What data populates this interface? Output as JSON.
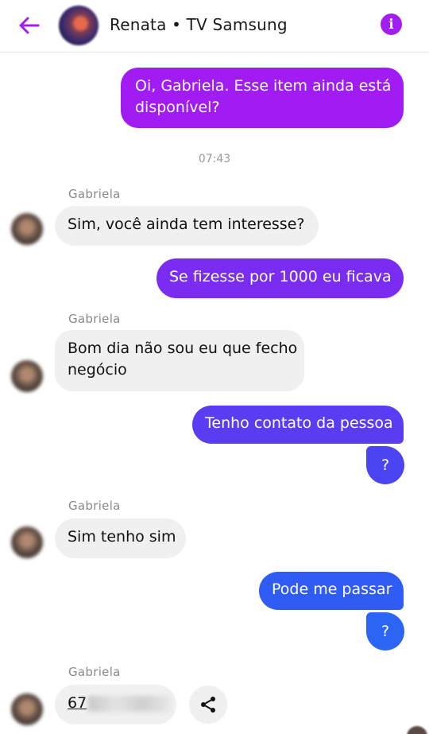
{
  "header": {
    "title": "Renata • TV Samsung",
    "back_icon": "arrow-left-icon",
    "info_icon": "info-icon",
    "info_glyph": "i",
    "accent": "#a21ef0"
  },
  "messages": {
    "m1": {
      "text_line1": "Oi, Gabriela. Esse item ainda está",
      "text_line2": "disponível?",
      "color": "#a01cf2"
    },
    "time1": "07:43",
    "s1": "Gabriela",
    "m2": {
      "text": "Sim, você ainda tem interesse?"
    },
    "m3": {
      "text": "Se fizesse por 1000 eu ficava",
      "color": "#7a2cf2"
    },
    "s2": "Gabriela",
    "m4": {
      "text_line1": "Bom dia não sou eu que fecho",
      "text_line2": "negócio"
    },
    "m5": {
      "text": "Tenho contato da pessoa",
      "color": "#5a3cf2"
    },
    "q1": "?",
    "s3": "Gabriela",
    "m6": {
      "text": "Sim tenho sim"
    },
    "m7": {
      "text": "Pode me passar",
      "color": "#2f5cf4"
    },
    "q2": "?",
    "s4": "Gabriela",
    "m8": {
      "text": "67"
    },
    "share_icon": "share-icon"
  }
}
